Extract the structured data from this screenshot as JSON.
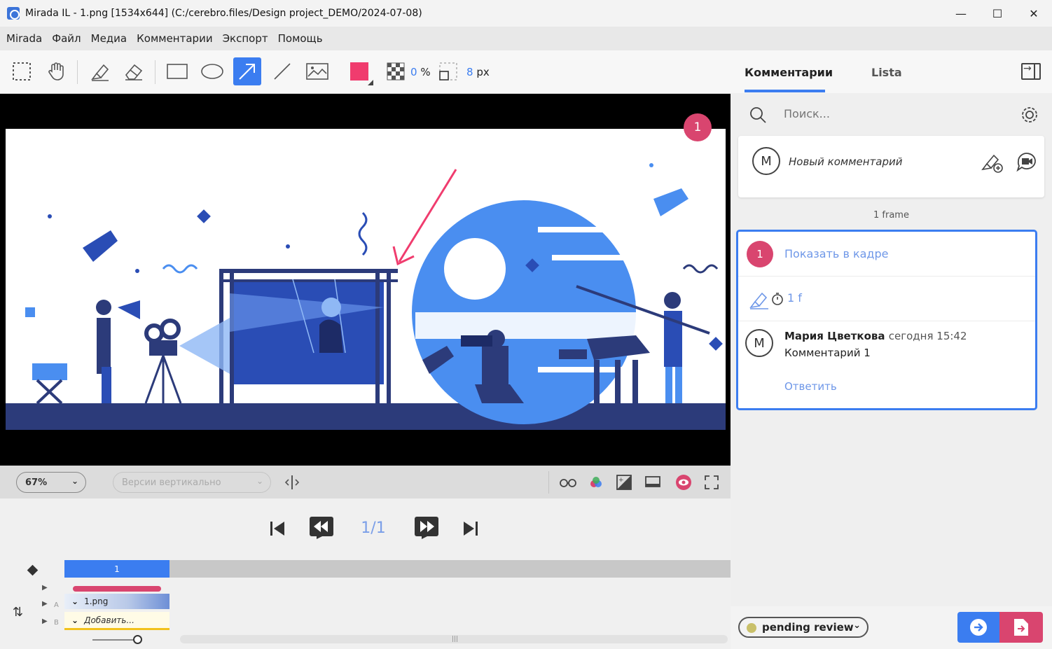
{
  "window": {
    "title": "Mirada IL - 1.png [1534x644] (C:/cerebro.files/Design project_DEMO/2024-07-08)",
    "minimize": "—",
    "maximize": "☐",
    "close": "✕"
  },
  "menu": [
    "Mirada",
    "Файл",
    "Медиа",
    "Комментарии",
    "Экспорт",
    "Помощь"
  ],
  "toolbar": {
    "opacity_value": "0",
    "opacity_unit": "%",
    "stroke_value": "8",
    "stroke_unit": "px",
    "color": "#f03c6e"
  },
  "viewer": {
    "marker_number": "1",
    "zoom": "67%",
    "versions_placeholder": "Версии вертикально"
  },
  "playback": {
    "frame_counter": "1/1",
    "timeline_frame": "1",
    "track_file": "1.png",
    "track_add": "Добавить...",
    "track_a": "A",
    "track_b": "B"
  },
  "panel": {
    "tabs": [
      "Комментарии",
      "Lista"
    ],
    "search_placeholder": "Поиск...",
    "new_comment_avatar": "M",
    "new_comment_placeholder": "Новый комментарий",
    "frame_label": "1 frame",
    "comment": {
      "badge": "1",
      "show_in_frame": "Показать в кадре",
      "duration": "1 f",
      "avatar": "M",
      "author": "Мария Цветкова",
      "time": "сегодня 15:42",
      "text": "Комментарий  1",
      "reply": "Ответить"
    },
    "status": "pending review"
  }
}
